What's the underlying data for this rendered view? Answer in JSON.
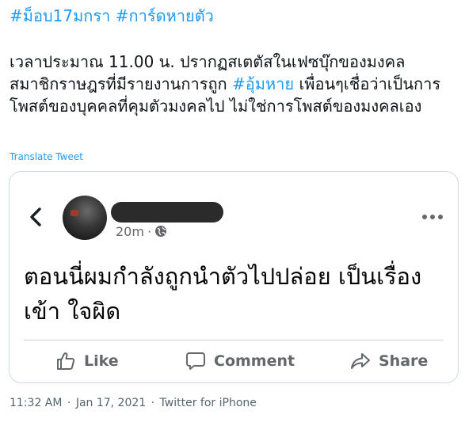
{
  "tweet": {
    "hashtags": [
      "#ม็อบ17มกรา",
      "#การ์ดหายตัว"
    ],
    "text_part1": "เวลาประมาณ 11.00 น. ปรากฏสเตตัสในเฟซบุ๊กของมงคล สมาชิกราษฎรที่มีรายงานการถูก ",
    "inline_hashtag": "#อุ้มหาย",
    "text_part2": " เพื่อนๆเชื่อว่าเป็นการโพสต์ของบุคคลที่คุมตัวมงคลไป ไม่ใช่การโพสต์ของมงคลเอง",
    "translate_label": "Translate Tweet",
    "time": "11:32 AM",
    "separator": "·",
    "date": "Jan 17, 2021",
    "source": "Twitter for iPhone"
  },
  "fb_post": {
    "time_ago": "20m",
    "dot": "·",
    "post_text": "ตอนนี่ผมกำลังถูกนำตัวไปปล่อย เป็นเรื่องเข้า ใจผิด",
    "actions": {
      "like": "Like",
      "comment": "Comment",
      "share": "Share"
    }
  },
  "colors": {
    "twitter_blue": "#1d9bf0",
    "text_primary": "#0f1419",
    "text_secondary": "#536471",
    "fb_gray": "#65676b",
    "border": "#cfd9de"
  },
  "icons": [
    "back-chevron-icon",
    "globe-icon",
    "more-dots-icon",
    "like-thumb-icon",
    "comment-bubble-icon",
    "share-arrow-icon"
  ]
}
